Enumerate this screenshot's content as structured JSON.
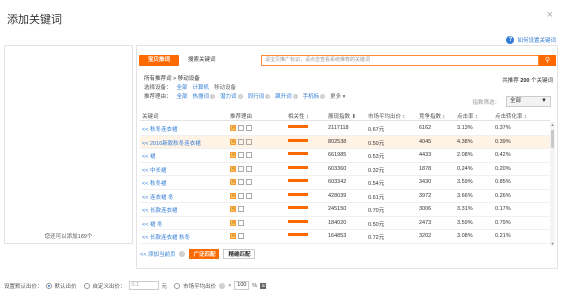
{
  "dialog": {
    "title": "添加关键词",
    "close_icon": "×",
    "help_label": "如何设置关键词"
  },
  "left": {
    "hint": "您还可以添加189个"
  },
  "tabs": [
    {
      "label": "宝贝推词"
    },
    {
      "label": "搜索关键词"
    }
  ],
  "search": {
    "placeholder": "请宝贝推广标识，请点击查看系统推荐的关键词"
  },
  "filters": {
    "breadcrumb": "所有推荐词 > 移动设备",
    "device_label": "选择设备：",
    "device_all": "全部",
    "device_pc": "计算机",
    "device_mobile": "移动设备",
    "reason_label": "推荐理由：",
    "reason_all": "全部",
    "reasons": [
      "热搜词",
      "潜力词",
      "同行词",
      "飙升词",
      "手机标"
    ],
    "more": "更多 ▾",
    "total_prefix": "共推荐",
    "total_count": "200",
    "total_suffix": "个关键词",
    "filter_label": "指数筛选：",
    "filter_value": "全部"
  },
  "table": {
    "headers": [
      "关键词",
      "推荐理由",
      "相关性 ↕",
      "展现指数 ⬇",
      "市场平均出价 ↕",
      "竞争指数 ↕",
      "点击率 ↕",
      "点击转化率 ↕"
    ],
    "rows": [
      {
        "kw": "<< 秋冬连衣裙",
        "tags": [
          "o",
          "g",
          "g"
        ],
        "rel": 5,
        "imp": "2117118",
        "price": "0.67元",
        "comp": "6162",
        "ctr": "3.13%",
        "cvr": "0.37%",
        "hl": false
      },
      {
        "kw": "<< 2016新款秋冬连衣裙",
        "tags": [
          "o",
          "g",
          "g"
        ],
        "rel": 5,
        "imp": "802538",
        "price": "0.50元",
        "comp": "4045",
        "ctr": "4.38%",
        "cvr": "0.39%",
        "hl": true
      },
      {
        "kw": "<< 裙",
        "tags": [
          "o",
          "g",
          "g"
        ],
        "rel": 5,
        "imp": "661985",
        "price": "0.53元",
        "comp": "4433",
        "ctr": "2.08%",
        "cvr": "0.42%",
        "hl": false
      },
      {
        "kw": "<< 中长裙",
        "tags": [
          "o",
          "g",
          "g"
        ],
        "rel": 5,
        "imp": "603360",
        "price": "0.32元",
        "comp": "1878",
        "ctr": "0.24%",
        "cvr": "0.20%",
        "hl": false
      },
      {
        "kw": "<< 秋冬裙",
        "tags": [
          "o",
          "g",
          "g"
        ],
        "rel": 5,
        "imp": "603342",
        "price": "0.54元",
        "comp": "3430",
        "ctr": "3.59%",
        "cvr": "0.85%",
        "hl": false
      },
      {
        "kw": "<< 连衣裙 冬",
        "tags": [
          "o",
          "g",
          "g"
        ],
        "rel": 5,
        "imp": "428039",
        "price": "0.61元",
        "comp": "3972",
        "ctr": "3.66%",
        "cvr": "0.26%",
        "hl": false
      },
      {
        "kw": "<< 长款连衣裙",
        "tags": [
          "o",
          "g"
        ],
        "rel": 5,
        "imp": "245150",
        "price": "0.70元",
        "comp": "3006",
        "ctr": "3.31%",
        "cvr": "0.17%",
        "hl": false
      },
      {
        "kw": "<< 裙 冬",
        "tags": [
          "o",
          "g"
        ],
        "rel": 5,
        "imp": "184020",
        "price": "0.50元",
        "comp": "2473",
        "ctr": "3.59%",
        "cvr": "0.79%",
        "hl": false
      },
      {
        "kw": "<< 长款连衣裙 秋冬",
        "tags": [
          "o",
          "g"
        ],
        "rel": 5,
        "imp": "164853",
        "price": "0.72元",
        "comp": "3202",
        "ctr": "3.08%",
        "cvr": "0.21%",
        "hl": false
      }
    ]
  },
  "footer": {
    "add_page": "<< 添加当前页",
    "broad_match": "广泛匹配",
    "exact_match": "精确匹配"
  },
  "bottom": {
    "label": "设置默认出价：",
    "opt_default": "默认出价",
    "opt_custom": "自定义出价：",
    "custom_placeholder": "0.1",
    "unit": "元",
    "opt_market": "市场平均出价",
    "times": "×",
    "percent_value": "100",
    "percent": "%"
  }
}
